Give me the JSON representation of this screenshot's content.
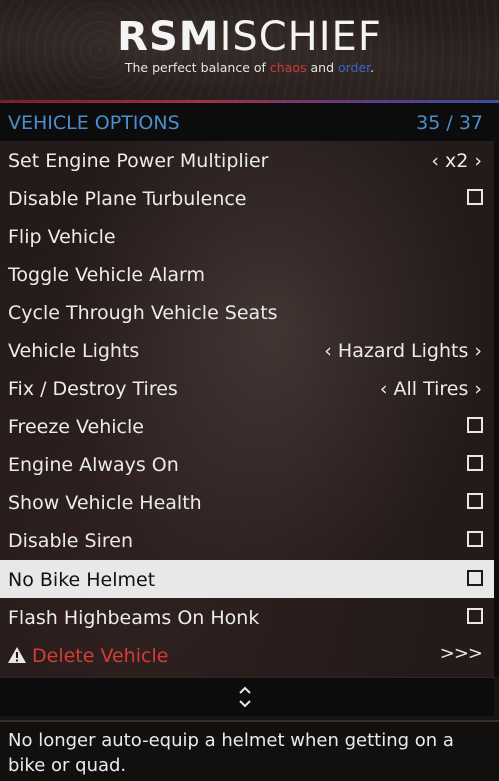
{
  "banner": {
    "logo_bold": "RSM",
    "logo_light": "ISCHIEF",
    "tagline_prefix": "The perfect balance of ",
    "tagline_chaos": "chaos",
    "tagline_mid": " and ",
    "tagline_order": "order",
    "tagline_suffix": "."
  },
  "header": {
    "title": "VEHICLE OPTIONS",
    "count": "35 / 37"
  },
  "items": [
    {
      "label": "Set Engine Power Multiplier",
      "value": "‹ x2 ›"
    },
    {
      "label": "Disable Plane Turbulence"
    },
    {
      "label": "Flip Vehicle"
    },
    {
      "label": "Toggle Vehicle Alarm"
    },
    {
      "label": "Cycle Through Vehicle Seats"
    },
    {
      "label": "Vehicle Lights",
      "value": "‹ Hazard Lights ›"
    },
    {
      "label": "Fix / Destroy Tires",
      "value": "‹ All Tires ›"
    },
    {
      "label": "Freeze Vehicle"
    },
    {
      "label": "Engine Always On"
    },
    {
      "label": "Show Vehicle Health"
    },
    {
      "label": "Disable Siren"
    },
    {
      "label": "No Bike Helmet"
    },
    {
      "label": "Flash Highbeams On Honk"
    },
    {
      "label": "Delete Vehicle",
      "value": ">>>"
    }
  ],
  "description": "No longer auto-equip a helmet when getting on a bike or quad.",
  "colors": {
    "accent": "#4a8ecf",
    "danger": "#d63b35",
    "selected_bg": "#e8e8e8",
    "chaos": "#d23a33",
    "order": "#3a67c8"
  },
  "icons": [
    "warning-icon",
    "up-down-arrows-icon"
  ]
}
